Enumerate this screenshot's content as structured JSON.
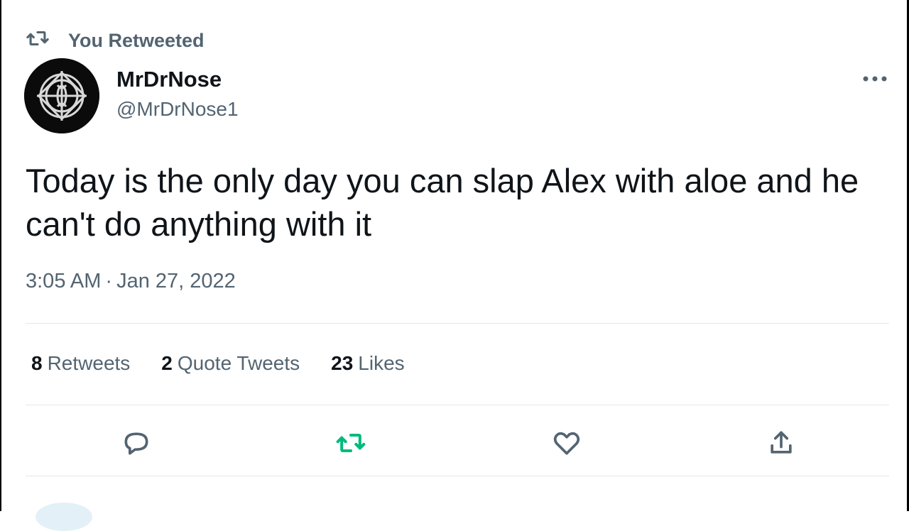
{
  "context": {
    "label": "You Retweeted",
    "icon": "retweet-icon",
    "color": "#536471"
  },
  "author": {
    "name": "MrDrNose",
    "handle": "@MrDrNose1",
    "avatar_icon": "avatar-emblem"
  },
  "tweet": {
    "text": "Today is the only day you can slap Alex with aloe and he can't do anything with it",
    "time": "3:05 AM",
    "separator": "·",
    "date": "Jan 27, 2022"
  },
  "stats": [
    {
      "count": "8",
      "label": "Retweets"
    },
    {
      "count": "2",
      "label": "Quote Tweets"
    },
    {
      "count": "23",
      "label": "Likes"
    }
  ],
  "actions": [
    {
      "name": "reply",
      "icon": "comment-icon"
    },
    {
      "name": "retweet",
      "icon": "retweet-icon",
      "active": true,
      "color": "#00ba7c"
    },
    {
      "name": "like",
      "icon": "heart-icon"
    },
    {
      "name": "share",
      "icon": "share-icon"
    }
  ],
  "colors": {
    "primary_text": "#0f1419",
    "secondary_text": "#536471",
    "divider": "#e3e7ea",
    "retweet_active": "#00ba7c"
  }
}
